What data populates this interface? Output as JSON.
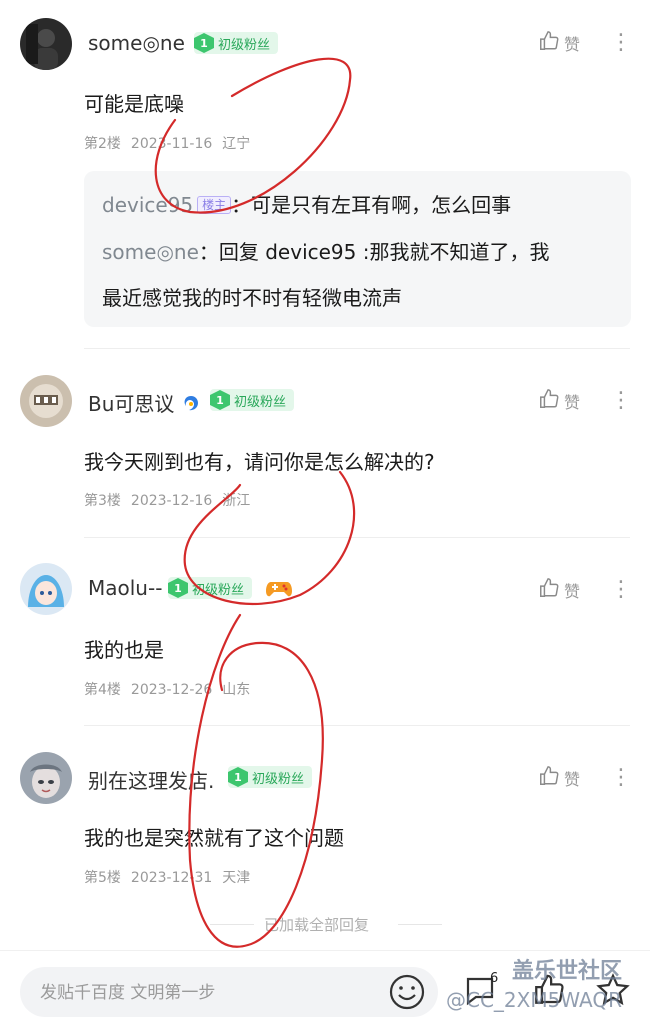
{
  "comments": [
    {
      "username": "some◎ne",
      "badge_level": "1",
      "badge_text": "初级粉丝",
      "content": "可能是底噪",
      "floor": "第2楼",
      "date": "2023-11-16",
      "location": "辽宁",
      "like_label": "赞",
      "replies": [
        {
          "name": "device95",
          "tag": "楼主",
          "sep": "：",
          "text": "可是只有左耳有啊，怎么回事"
        },
        {
          "name": "some◎ne",
          "sep": "：",
          "text_line1": "回复 device95 :那我就不知道了，我",
          "text_line2": "最近感觉我的时不时有轻微电流声"
        }
      ]
    },
    {
      "username": "Bu可思议",
      "badge_level": "1",
      "badge_text": "初级粉丝",
      "content": "我今天刚到也有，请问你是怎么解决的?",
      "floor": "第3楼",
      "date": "2023-12-16",
      "location": "浙江",
      "like_label": "赞"
    },
    {
      "username": "Maolu--",
      "badge_level": "1",
      "badge_text": "初级粉丝",
      "content": "我的也是",
      "floor": "第4楼",
      "date": "2023-12-26",
      "location": "山东",
      "like_label": "赞"
    },
    {
      "username": "别在这理发店.",
      "badge_level": "1",
      "badge_text": "初级粉丝",
      "content": "我的也是突然就有了这个问题",
      "floor": "第5楼",
      "date": "2023-12-31",
      "location": "天津",
      "like_label": "赞"
    }
  ],
  "loaded_all": "已加载全部回复",
  "bottom": {
    "input_placeholder": "发贴千百度 文明第一步",
    "comment_count": "6"
  },
  "watermark": {
    "line1": "盖乐世社区",
    "line2": "@CC_2XM5WAQR"
  },
  "colors": {
    "badge_green": "#3dc66e",
    "annotation_red": "#d42a2a",
    "reply_bg": "#f5f6f7"
  }
}
